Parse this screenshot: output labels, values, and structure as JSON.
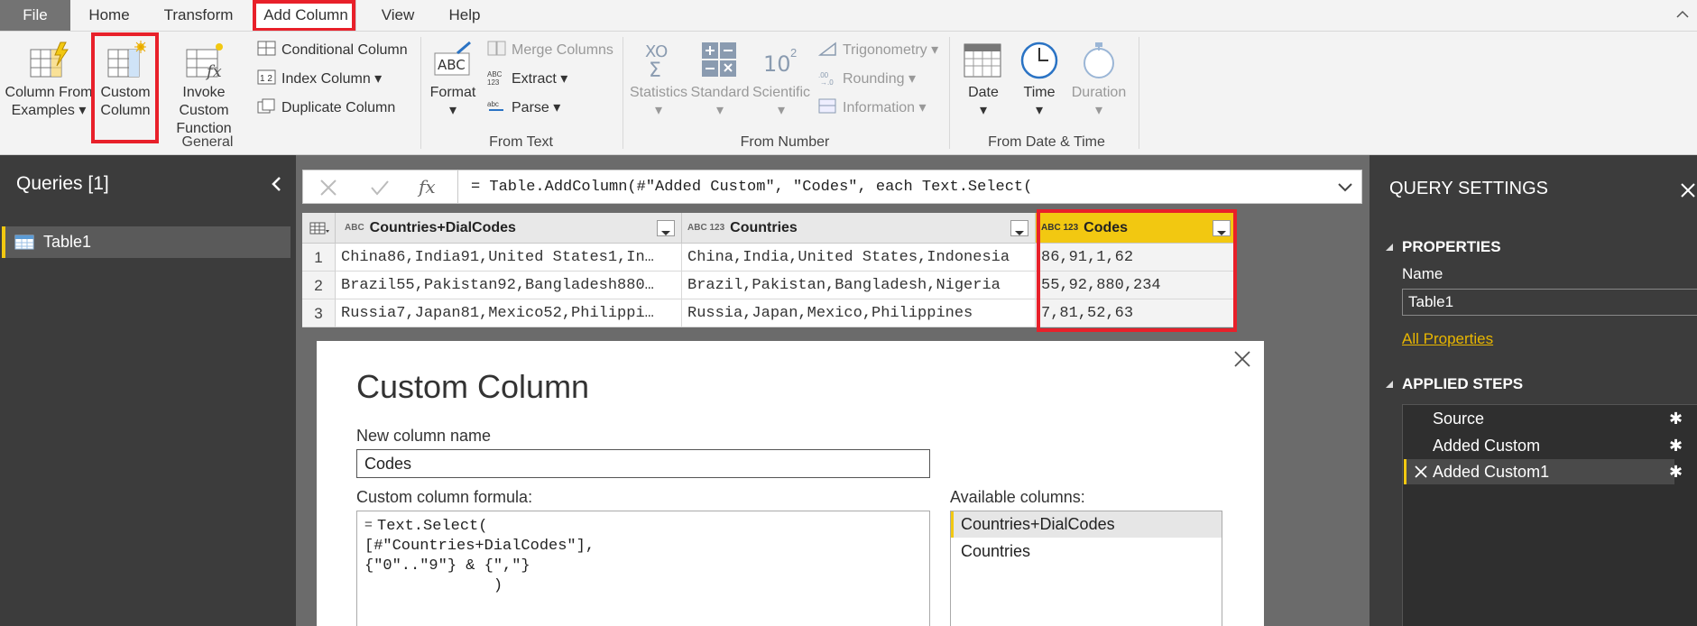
{
  "tabs": {
    "file": "File",
    "home": "Home",
    "transform": "Transform",
    "add_column": "Add Column",
    "view": "View",
    "help": "Help"
  },
  "ribbon": {
    "col_from_examples": [
      "Column From",
      "Examples ▾"
    ],
    "custom_column": [
      "Custom",
      "Column"
    ],
    "invoke_custom": [
      "Invoke Custom",
      "Function"
    ],
    "conditional_column": "Conditional Column",
    "index_column": "Index Column ▾",
    "duplicate_column": "Duplicate Column",
    "group_general": "General",
    "format": "Format",
    "merge_columns": "Merge Columns",
    "extract": "Extract ▾",
    "parse": "Parse ▾",
    "group_from_text": "From Text",
    "statistics": "Statistics",
    "standard": "Standard",
    "scientific": "Scientific",
    "trigonometry": "Trigonometry ▾",
    "rounding": "Rounding ▾",
    "information": "Information ▾",
    "group_from_number": "From Number",
    "date": "Date",
    "time": "Time",
    "duration": "Duration",
    "group_from_datetime": "From Date & Time",
    "stat_glyph": "XO",
    "sci_glyph": "10"
  },
  "queries": {
    "title": "Queries [1]",
    "items": [
      "Table1"
    ]
  },
  "formula_bar": {
    "fx": "fx",
    "text": "= Table.AddColumn(#\"Added Custom\", \"Codes\", each Text.Select("
  },
  "table": {
    "columns": [
      {
        "type": "ABC",
        "name": "Countries+DialCodes"
      },
      {
        "type": "ABC 123",
        "name": "Countries"
      },
      {
        "type": "ABC 123",
        "name": "Codes"
      }
    ],
    "rows": [
      {
        "n": "1",
        "c1": "China86,India91,United States1,In…",
        "c2": "China,India,United States,Indonesia",
        "c3": "86,91,1,62"
      },
      {
        "n": "2",
        "c1": "Brazil55,Pakistan92,Bangladesh880…",
        "c2": "Brazil,Pakistan,Bangladesh,Nigeria",
        "c3": "55,92,880,234"
      },
      {
        "n": "3",
        "c1": "Russia7,Japan81,Mexico52,Philippi…",
        "c2": "Russia,Japan,Mexico,Philippines",
        "c3": "7,81,52,63"
      }
    ]
  },
  "dialog": {
    "title": "Custom Column",
    "name_label": "New column name",
    "name_value": "Codes",
    "formula_label": "Custom column formula:",
    "formula_eq": "=",
    "formula_lines": [
      "Text.Select(",
      "[#\"Countries+DialCodes\"],",
      "{\"0\"..\"9\"} & {\",\"}",
      "              )"
    ],
    "avail_label": "Available columns:",
    "avail_items": [
      "Countries+DialCodes",
      "Countries"
    ]
  },
  "settings": {
    "title": "QUERY SETTINGS",
    "properties": "PROPERTIES",
    "name_label": "Name",
    "name_value": "Table1",
    "all_properties": "All Properties",
    "applied_steps": "APPLIED STEPS",
    "steps": [
      "Source",
      "Added Custom",
      "Added Custom1"
    ]
  },
  "colors": {
    "accent": "#f2c811",
    "highlight_red": "#e8202a",
    "link": "#e8b600"
  }
}
